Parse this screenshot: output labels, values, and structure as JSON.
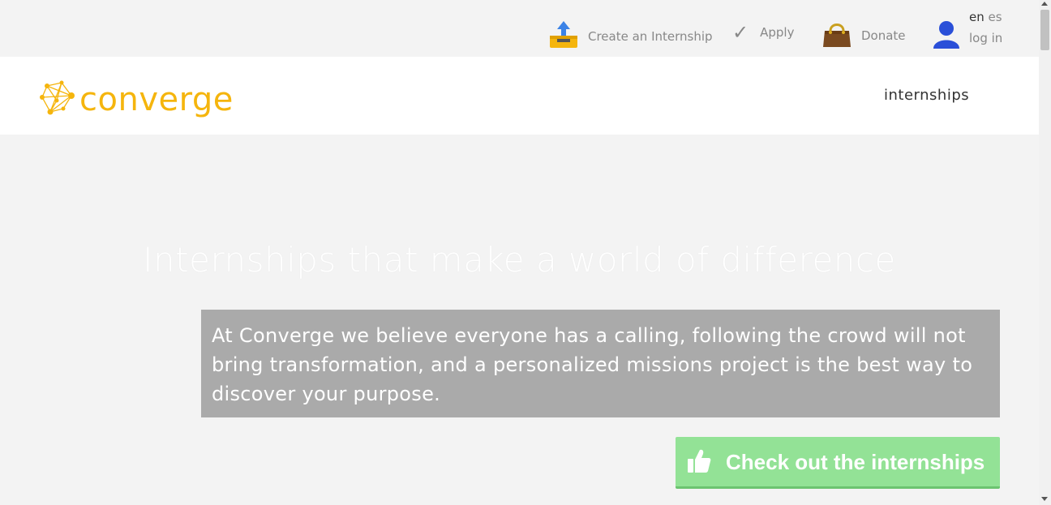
{
  "topbar": {
    "create_label": "Create an Internship",
    "apply_label": "Apply",
    "donate_label": "Donate",
    "lang_current": "en",
    "lang_other": "es",
    "login_label": "log in"
  },
  "navbar": {
    "logo_text": "converge",
    "nav_internships": "internships"
  },
  "hero": {
    "title": "Internships that make a world of difference",
    "description": "At Converge we believe everyone has a calling, following the crowd will not bring transformation, and a personalized missions project is the best way to discover your purpose.",
    "cta_label": "Check out the internships"
  },
  "colors": {
    "brand": "#f5b50d",
    "cta": "#93e296",
    "box": "#aaaaaa"
  }
}
